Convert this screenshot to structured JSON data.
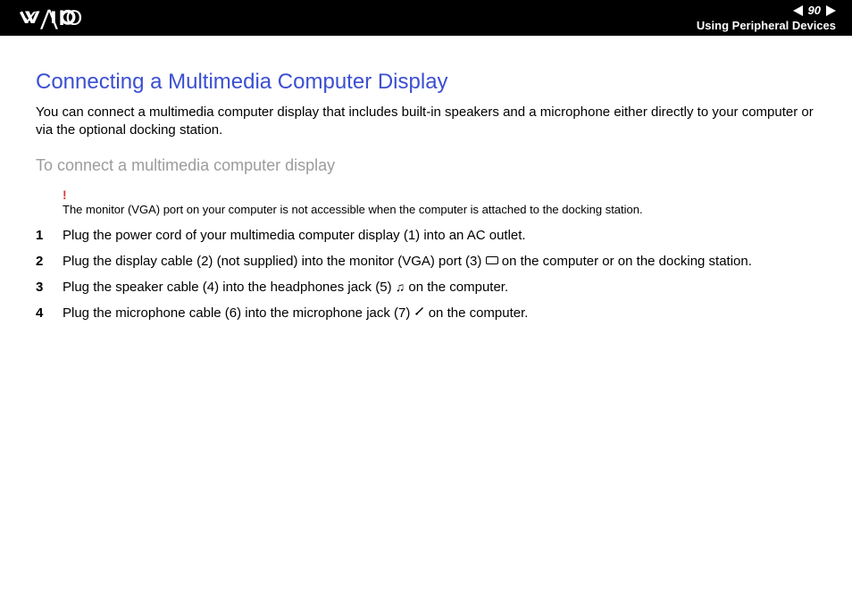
{
  "header": {
    "page_number": "90",
    "section": "Using Peripheral Devices"
  },
  "content": {
    "heading": "Connecting a Multimedia Computer Display",
    "intro": "You can connect a multimedia computer display that includes built-in speakers and a microphone either directly to your computer or via the optional docking station.",
    "subheading": "To connect a multimedia computer display",
    "note": {
      "mark": "!",
      "text": "The monitor (VGA) port on your computer is not accessible when the computer is attached to the docking station."
    },
    "steps": [
      {
        "num": "1",
        "text": "Plug the power cord of your multimedia computer display (1) into an AC outlet."
      },
      {
        "num": "2",
        "pre": "Plug the display cable (2) (not supplied) into the monitor (VGA) port (3) ",
        "post": " on the computer or on the docking station.",
        "icon": "vga"
      },
      {
        "num": "3",
        "pre": "Plug the speaker cable (4) into the headphones jack (5) ",
        "post": " on the computer.",
        "icon": "headphones"
      },
      {
        "num": "4",
        "pre": "Plug the microphone cable (6) into the microphone jack (7) ",
        "post": " on the computer.",
        "icon": "microphone"
      }
    ]
  }
}
